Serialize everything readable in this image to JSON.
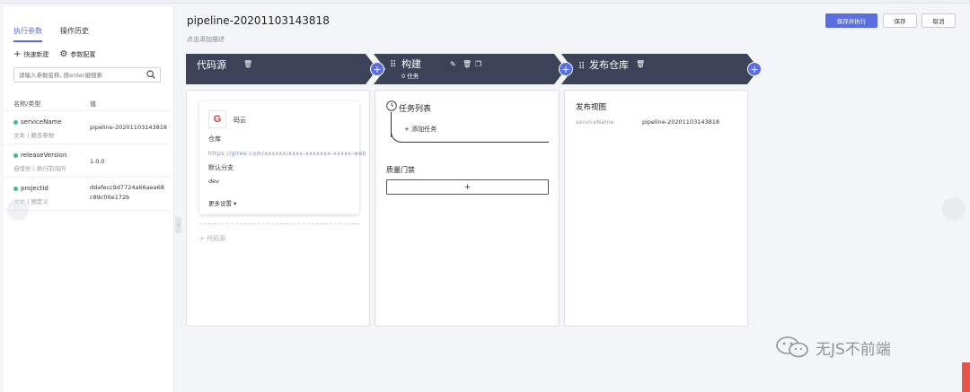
{
  "left": {
    "tabs": [
      {
        "label": "执行参数",
        "active": true
      },
      {
        "label": "操作历史",
        "active": false
      }
    ],
    "actions": {
      "quick_new": "快速新建",
      "param_config": "参数配置"
    },
    "search": {
      "placeholder": "请输入参数名称, 按enter键搜索"
    },
    "table": {
      "col_name": "名称/类型",
      "col_value": "值",
      "rows": [
        {
          "name": "serviceName",
          "type": "文本 | 静态参数",
          "value": "pipeline-20201103143818"
        },
        {
          "name": "releaseVersion",
          "type": "自增长 | 执行前询问",
          "value": "1.0.0"
        },
        {
          "name": "projectId",
          "type": "文本 | 预定义",
          "value": "ddafecc9d7724a66aea68c89c00e172b",
          "value_line1": "ddafecc9d7724a66aea68",
          "value_line2": "c89c00e172b"
        }
      ]
    }
  },
  "header": {
    "title": "pipeline-20201103143818",
    "description_placeholder": "点击添加描述",
    "buttons": {
      "save_run": "保存并执行",
      "save": "保存",
      "cancel": "取消"
    }
  },
  "stages": {
    "source": {
      "title": "代码源"
    },
    "build": {
      "title": "构建",
      "subtitle": "0 任务"
    },
    "publish": {
      "title": "发布仓库"
    }
  },
  "source_card": {
    "name": "码云",
    "repo_label": "仓库",
    "repo_url": "https://gitee.com/xxxxxx/xxxx-xxxxxxx-xxxxx-web",
    "branch_label": "默认分支",
    "branch": "dev",
    "more_settings": "更多设置",
    "add_source": "+ 代码源"
  },
  "build_card": {
    "task_list": "任务列表",
    "add_task": "添加任务",
    "quality_gate": "质量门禁",
    "gate_add": "+"
  },
  "publish_card": {
    "title": "发布视图",
    "key": "serviceName",
    "value": "pipeline-20201103143818"
  },
  "watermark": {
    "text": "无JS不前端"
  },
  "colors": {
    "accent": "#5b6ee1",
    "stage_bar": "#3c4257",
    "status_dot": "#3fba8a"
  }
}
